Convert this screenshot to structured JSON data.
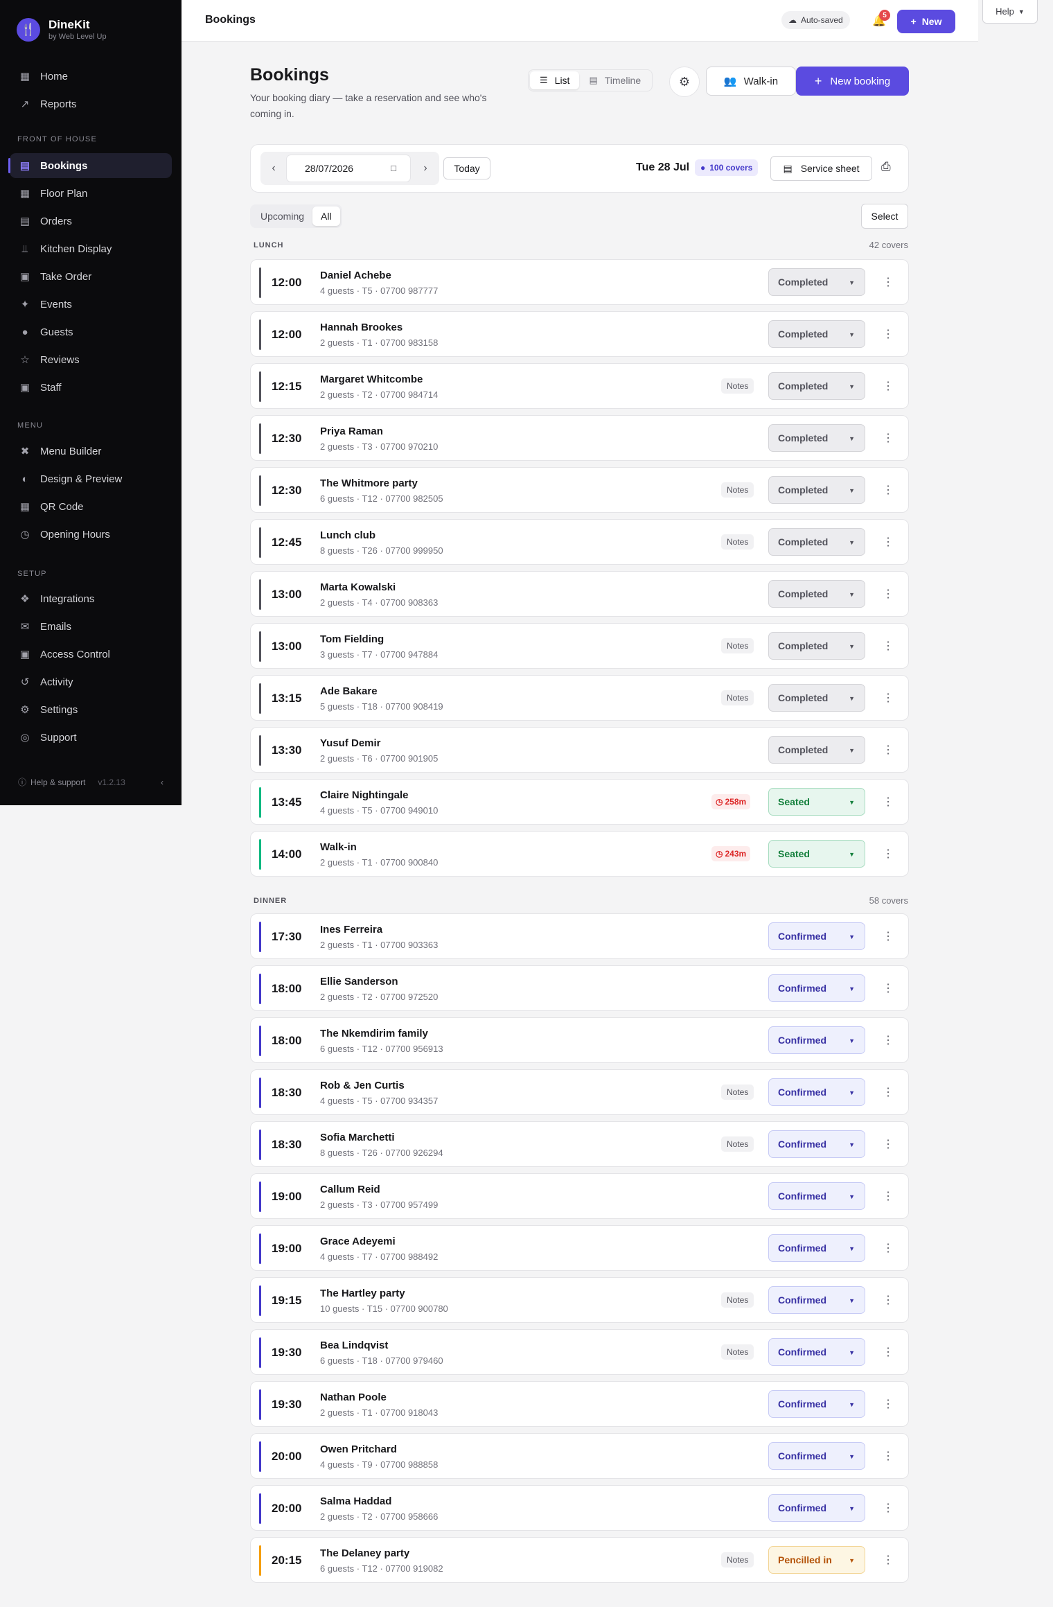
{
  "app": {
    "name": "DineKit",
    "subtitle": "by Web Level Up",
    "logo_icon": "fork-knife-icon"
  },
  "sidebar": {
    "top_items": [
      {
        "label": "Home",
        "icon": "home-icon"
      },
      {
        "label": "Reports",
        "icon": "trend-icon"
      }
    ],
    "sections": [
      {
        "title": "FRONT OF HOUSE",
        "items": [
          {
            "label": "Bookings",
            "icon": "calendar-icon",
            "active": true
          },
          {
            "label": "Floor Plan",
            "icon": "grid-icon"
          },
          {
            "label": "Orders",
            "icon": "receipt-icon"
          },
          {
            "label": "Kitchen Display",
            "icon": "utensils-icon"
          },
          {
            "label": "Take Order",
            "icon": "register-icon"
          },
          {
            "label": "Events",
            "icon": "party-icon"
          },
          {
            "label": "Guests",
            "icon": "users-icon"
          },
          {
            "label": "Reviews",
            "icon": "star-icon"
          },
          {
            "label": "Staff",
            "icon": "briefcase-icon"
          }
        ]
      },
      {
        "title": "MENU",
        "items": [
          {
            "label": "Menu Builder",
            "icon": "tools-icon"
          },
          {
            "label": "Design & Preview",
            "icon": "palette-icon"
          },
          {
            "label": "QR Code",
            "icon": "qr-icon"
          },
          {
            "label": "Opening Hours",
            "icon": "clock-icon"
          }
        ]
      },
      {
        "title": "SETUP",
        "items": [
          {
            "label": "Integrations",
            "icon": "puzzle-icon"
          },
          {
            "label": "Emails",
            "icon": "mail-icon"
          },
          {
            "label": "Access Control",
            "icon": "lock-icon"
          },
          {
            "label": "Activity",
            "icon": "history-icon"
          },
          {
            "label": "Settings",
            "icon": "gear-icon"
          },
          {
            "label": "Support",
            "icon": "lifebuoy-icon"
          }
        ]
      }
    ],
    "footer": {
      "help": "Help & support",
      "version": "v1.2.13"
    }
  },
  "topbar": {
    "title": "Bookings",
    "autosaved": "Auto-saved",
    "notifications": "5",
    "new_label": "New",
    "help_label": "Help"
  },
  "page": {
    "title": "Bookings",
    "description": "Your booking diary — take a reservation and see who's coming in.",
    "views": {
      "list": "List",
      "timeline": "Timeline"
    },
    "walkin": "Walk-in",
    "new_booking": "New booking"
  },
  "datebar": {
    "date_value": "28/07/2026",
    "today": "Today",
    "date_label": "Tue 28 Jul",
    "covers": "100 covers",
    "service_sheet": "Service sheet"
  },
  "filters": {
    "upcoming": "Upcoming",
    "all": "All",
    "select": "Select"
  },
  "colors": {
    "accent": "#5b4be0",
    "completed": "#52525b",
    "seated": "#10b981",
    "confirmed": "#4338ca",
    "pencilled": "#f59e0b"
  },
  "sections": [
    {
      "name": "LUNCH",
      "covers": "42 covers",
      "bookings": [
        {
          "time": "12:00",
          "name": "Daniel Achebe",
          "meta": "4 guests · T5 · 07700 987777",
          "status": "Completed"
        },
        {
          "time": "12:00",
          "name": "Hannah Brookes",
          "meta": "2 guests · T1 · 07700 983158",
          "status": "Completed"
        },
        {
          "time": "12:15",
          "name": "Margaret Whitcombe",
          "meta": "2 guests · T2 · 07700 984714",
          "notes": "Notes",
          "status": "Completed"
        },
        {
          "time": "12:30",
          "name": "Priya Raman",
          "meta": "2 guests · T3 · 07700 970210",
          "status": "Completed"
        },
        {
          "time": "12:30",
          "name": "The Whitmore party",
          "meta": "6 guests · T12 · 07700 982505",
          "notes": "Notes",
          "status": "Completed"
        },
        {
          "time": "12:45",
          "name": "Lunch club",
          "meta": "8 guests · T26 · 07700 999950",
          "notes": "Notes",
          "status": "Completed"
        },
        {
          "time": "13:00",
          "name": "Marta Kowalski",
          "meta": "2 guests · T4 · 07700 908363",
          "status": "Completed"
        },
        {
          "time": "13:00",
          "name": "Tom Fielding",
          "meta": "3 guests · T7 · 07700 947884",
          "notes": "Notes",
          "status": "Completed"
        },
        {
          "time": "13:15",
          "name": "Ade Bakare",
          "meta": "5 guests · T18 · 07700 908419",
          "notes": "Notes",
          "status": "Completed"
        },
        {
          "time": "13:30",
          "name": "Yusuf Demir",
          "meta": "2 guests · T6 · 07700 901905",
          "status": "Completed"
        },
        {
          "time": "13:45",
          "name": "Claire Nightingale",
          "meta": "4 guests · T5 · 07700 949010",
          "timer": "258m",
          "status": "Seated"
        },
        {
          "time": "14:00",
          "name": "Walk-in",
          "meta": "2 guests · T1 · 07700 900840",
          "timer": "243m",
          "status": "Seated"
        }
      ]
    },
    {
      "name": "DINNER",
      "covers": "58 covers",
      "bookings": [
        {
          "time": "17:30",
          "name": "Ines Ferreira",
          "meta": "2 guests · T1 · 07700 903363",
          "status": "Confirmed"
        },
        {
          "time": "18:00",
          "name": "Ellie Sanderson",
          "meta": "2 guests · T2 · 07700 972520",
          "status": "Confirmed"
        },
        {
          "time": "18:00",
          "name": "The Nkemdirim family",
          "meta": "6 guests · T12 · 07700 956913",
          "status": "Confirmed"
        },
        {
          "time": "18:30",
          "name": "Rob & Jen Curtis",
          "meta": "4 guests · T5 · 07700 934357",
          "notes": "Notes",
          "status": "Confirmed"
        },
        {
          "time": "18:30",
          "name": "Sofia Marchetti",
          "meta": "8 guests · T26 · 07700 926294",
          "notes": "Notes",
          "status": "Confirmed"
        },
        {
          "time": "19:00",
          "name": "Callum Reid",
          "meta": "2 guests · T3 · 07700 957499",
          "status": "Confirmed"
        },
        {
          "time": "19:00",
          "name": "Grace Adeyemi",
          "meta": "4 guests · T7 · 07700 988492",
          "status": "Confirmed"
        },
        {
          "time": "19:15",
          "name": "The Hartley party",
          "meta": "10 guests · T15 · 07700 900780",
          "notes": "Notes",
          "status": "Confirmed"
        },
        {
          "time": "19:30",
          "name": "Bea Lindqvist",
          "meta": "6 guests · T18 · 07700 979460",
          "notes": "Notes",
          "status": "Confirmed"
        },
        {
          "time": "19:30",
          "name": "Nathan Poole",
          "meta": "2 guests · T1 · 07700 918043",
          "status": "Confirmed"
        },
        {
          "time": "20:00",
          "name": "Owen Pritchard",
          "meta": "4 guests · T9 · 07700 988858",
          "status": "Confirmed"
        },
        {
          "time": "20:00",
          "name": "Salma Haddad",
          "meta": "2 guests · T2 · 07700 958666",
          "status": "Confirmed"
        },
        {
          "time": "20:15",
          "name": "The Delaney party",
          "meta": "6 guests · T12 · 07700 919082",
          "notes": "Notes",
          "status": "Pencilled in"
        }
      ]
    }
  ]
}
